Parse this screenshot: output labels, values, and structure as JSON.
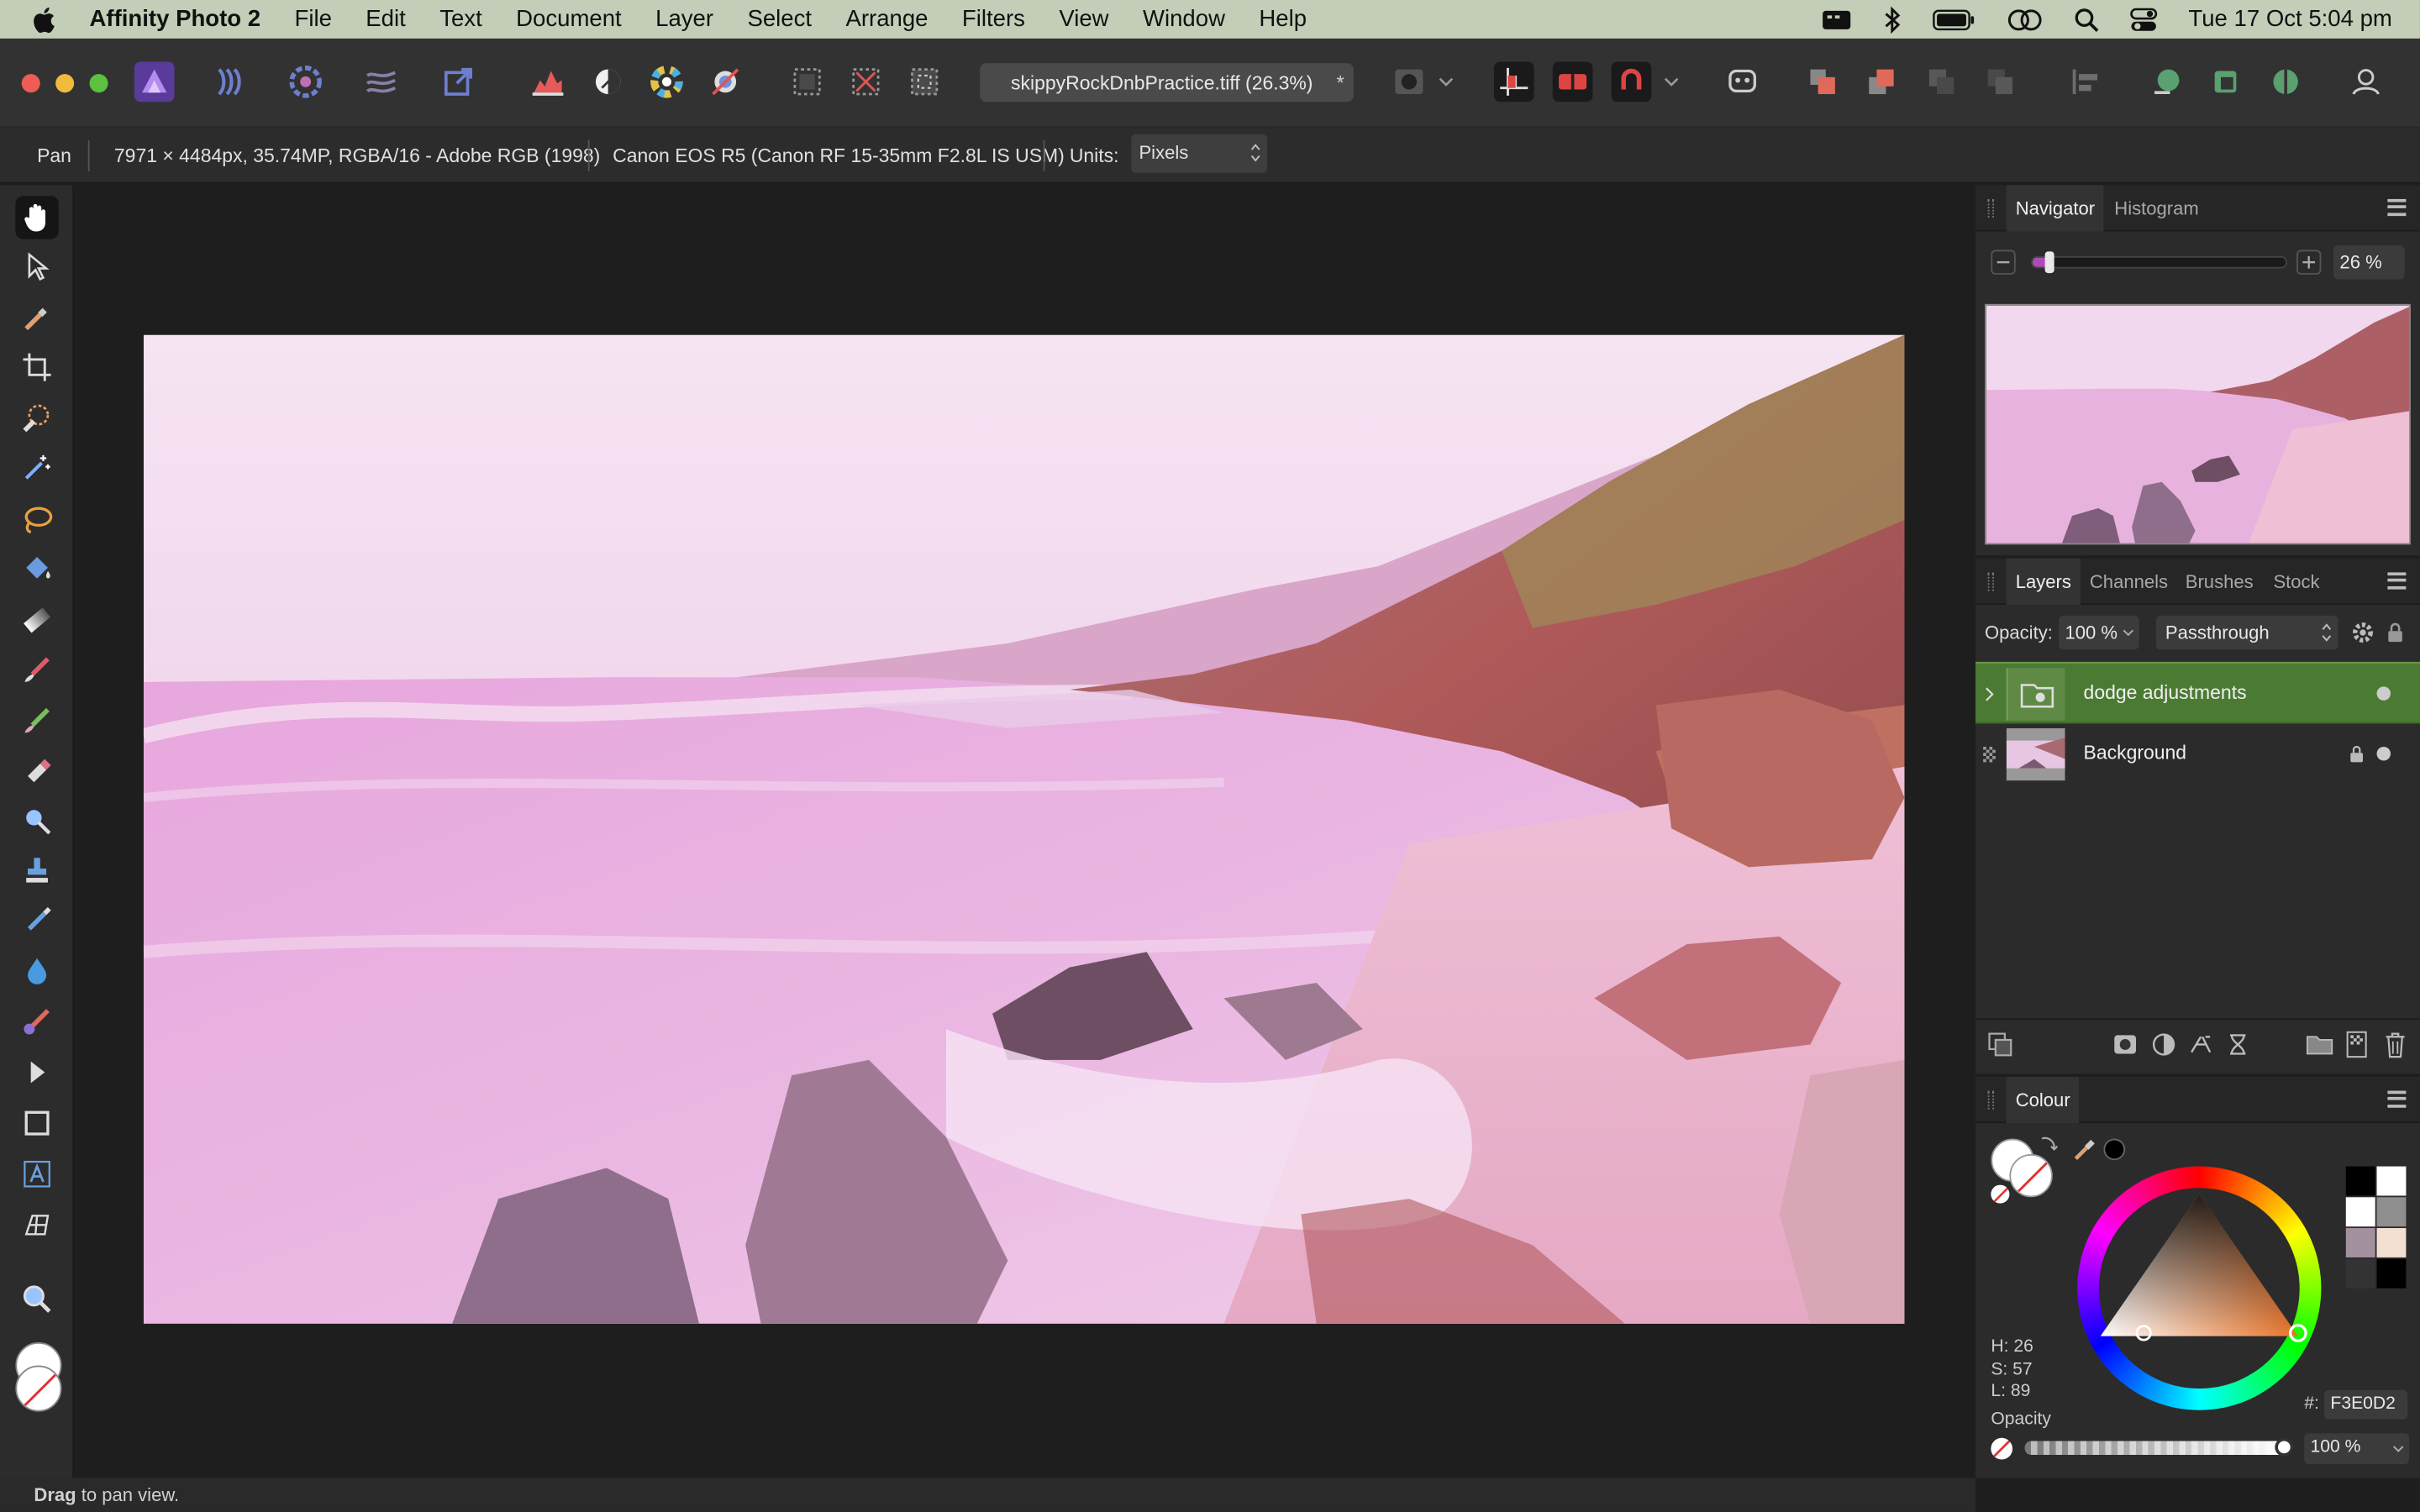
{
  "menubar": {
    "app_name": "Affinity Photo 2",
    "menus": [
      "File",
      "Edit",
      "Text",
      "Document",
      "Layer",
      "Select",
      "Arrange",
      "Filters",
      "View",
      "Window",
      "Help"
    ],
    "clock": "Tue 17 Oct  5:04 pm"
  },
  "toolbar": {
    "document_title": "skippyRockDnbPractice.tiff (26.3%)",
    "modified_mark": "*"
  },
  "context": {
    "tool_name": "Pan",
    "doc_info": "7971 × 4484px, 35.74MP, RGBA/16 - Adobe RGB (1998)",
    "camera": "Canon EOS R5 (Canon RF 15-35mm F2.8L IS USM)",
    "units_label": "Units:",
    "units_value": "Pixels"
  },
  "navigator": {
    "tabs": [
      "Navigator",
      "Histogram"
    ],
    "zoom_value": "26 %",
    "zoom_fraction": 0.07
  },
  "layers": {
    "tabs": [
      "Layers",
      "Channels",
      "Brushes",
      "Stock"
    ],
    "opacity_label": "Opacity:",
    "opacity_value": "100 %",
    "blend_mode": "Passthrough",
    "items": [
      {
        "name": "dodge adjustments",
        "selected": true
      },
      {
        "name": "Background",
        "locked": true
      }
    ]
  },
  "colour": {
    "tab": "Colour",
    "h": "H: 26",
    "s": "S: 57",
    "l": "L: 89",
    "hex_label": "#:",
    "hex_value": "F3E0D2",
    "opacity_label": "Opacity",
    "opacity_value": "100 %",
    "accent": "#F3E0D2"
  },
  "status": {
    "bold": "Drag",
    "text": " to pan view."
  }
}
